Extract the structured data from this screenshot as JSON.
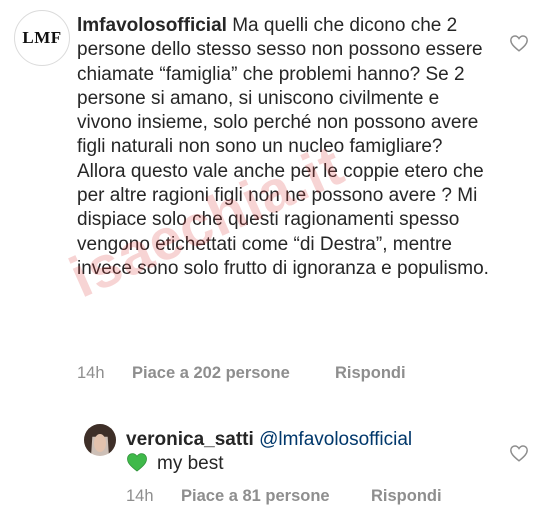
{
  "comments": [
    {
      "username": "lmfavolosofficial",
      "avatar_text": "LMF",
      "text": "Ma quelli che dicono che 2 persone dello stesso sesso non possono essere chiamate “famiglia” che problemi hanno? Se 2 persone si amano, si uniscono civilmente e vivono insieme, solo perché non possono avere figli naturali non sono un nucleo famigliare? Allora questo vale anche per le coppie etero che per altre ragioni figli non ne possono avere ? Mi dispiace solo che questi ragionamenti spesso vengono etichettati come “di Destra”, mentre invece sono solo frutto di ignoranza e populismo.",
      "time": "14h",
      "likes": "Piace a 202 persone",
      "reply": "Rispondi",
      "icon": "heart-outline-icon"
    },
    {
      "username": "veronica_satti",
      "mention": "@lmfavolosofficial",
      "emoji": "green-heart-emoji",
      "text": "my best",
      "time": "14h",
      "likes": "Piace a 81 persone",
      "reply": "Rispondi",
      "icon": "heart-outline-icon"
    }
  ],
  "watermark": "isaechia.it",
  "colors": {
    "text": "#262626",
    "meta": "#8e8e8e",
    "mention": "#00376b",
    "green_heart": "#3fb94a",
    "watermark": "#dc3c3c"
  }
}
